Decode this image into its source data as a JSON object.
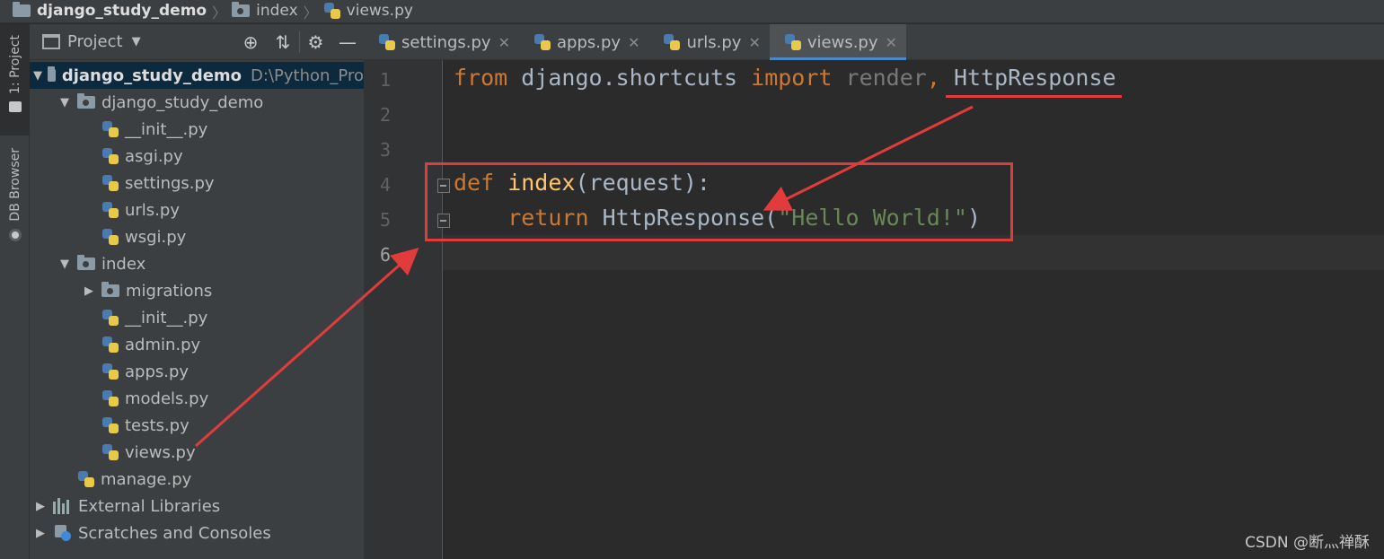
{
  "breadcrumb": [
    {
      "label": "django_study_demo",
      "bold": true
    },
    {
      "label": "index",
      "bold": false
    },
    {
      "label": "views.py",
      "bold": false
    }
  ],
  "toolstrip": {
    "project_label": "1: Project",
    "db_label": "DB Browser"
  },
  "project_panel": {
    "title": "Project",
    "tree": [
      {
        "label": "django_study_demo",
        "path": "D:\\Python_Pro",
        "level": 0,
        "type": "folder",
        "expanded": true,
        "selected": true
      },
      {
        "label": "django_study_demo",
        "level": 1,
        "type": "folder",
        "expanded": true
      },
      {
        "label": "__init__.py",
        "level": 2,
        "type": "py"
      },
      {
        "label": "asgi.py",
        "level": 2,
        "type": "py"
      },
      {
        "label": "settings.py",
        "level": 2,
        "type": "py"
      },
      {
        "label": "urls.py",
        "level": 2,
        "type": "py"
      },
      {
        "label": "wsgi.py",
        "level": 2,
        "type": "py"
      },
      {
        "label": "index",
        "level": 1,
        "type": "folder",
        "expanded": true
      },
      {
        "label": "migrations",
        "level": 2,
        "type": "folder",
        "expanded": false
      },
      {
        "label": "__init__.py",
        "level": 2,
        "type": "py"
      },
      {
        "label": "admin.py",
        "level": 2,
        "type": "py"
      },
      {
        "label": "apps.py",
        "level": 2,
        "type": "py"
      },
      {
        "label": "models.py",
        "level": 2,
        "type": "py"
      },
      {
        "label": "tests.py",
        "level": 2,
        "type": "py"
      },
      {
        "label": "views.py",
        "level": 2,
        "type": "py"
      },
      {
        "label": "manage.py",
        "level": 1,
        "type": "py"
      },
      {
        "label": "External Libraries",
        "level": 0,
        "type": "libs",
        "expanded": false
      },
      {
        "label": "Scratches and Consoles",
        "level": 0,
        "type": "scratch",
        "expanded": false
      }
    ]
  },
  "tabs": [
    {
      "label": "settings.py",
      "active": false
    },
    {
      "label": "apps.py",
      "active": false
    },
    {
      "label": "urls.py",
      "active": false
    },
    {
      "label": "views.py",
      "active": true
    }
  ],
  "editor": {
    "line_numbers": [
      "1",
      "2",
      "3",
      "4",
      "5",
      "6"
    ],
    "current_line": "6",
    "code": {
      "l1_from": "from",
      "l1_module": " django.shortcuts ",
      "l1_import": "import",
      "l1_render": " render",
      "l1_comma": ", ",
      "l1_http": "HttpResponse",
      "l4_def": "def",
      "l4_name": " index",
      "l4_args": "(request):",
      "l5_return": "    return",
      "l5_call": " HttpResponse(",
      "l5_str": "\"Hello World!\"",
      "l5_close": ")"
    }
  },
  "watermark": "CSDN @断灬禅酥",
  "colors": {
    "annotation": "#e23b3b",
    "keyword": "#cc7832",
    "function": "#ffc66d",
    "string": "#6a8759",
    "tab_accent": "#4a88c7"
  }
}
